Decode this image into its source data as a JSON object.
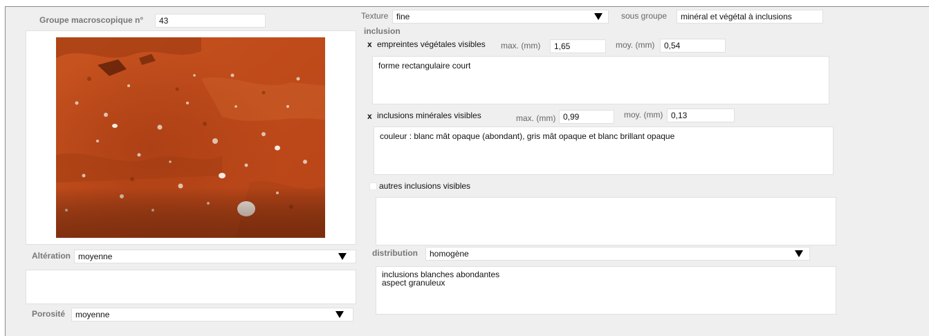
{
  "left": {
    "groupe_label": "Groupe macroscopique n°",
    "groupe_value": "43",
    "photo_icon": "soil-sample-photo",
    "alteration_label": "Altération",
    "alteration_value": "moyenne",
    "alteration_notes": "",
    "porosite_label": "Porosité",
    "porosite_value": "moyenne",
    "dropdown_icon": "triangle-down-icon"
  },
  "right": {
    "texture_label": "Texture",
    "texture_value": "fine",
    "sous_groupe_label": "sous groupe",
    "sous_groupe_value": "minéral et végétal à inclusions",
    "inclusion_heading": "inclusion",
    "veg": {
      "check": "x",
      "label": "empreintes végétales visibles",
      "max_label": "max. (mm)",
      "max_value": "1,65",
      "moy_label": "moy. (mm)",
      "moy_value": "0,54",
      "notes": "forme rectangulaire court"
    },
    "min": {
      "check": "x",
      "label": "inclusions minérales visibles",
      "max_label": "max. (mm)",
      "max_value": "0,99",
      "moy_label": "moy. (mm)",
      "moy_value": "0,13",
      "notes": "couleur : blanc mât opaque (abondant), gris mât opaque et blanc brillant opaque"
    },
    "autres": {
      "label": "autres inclusions visibles",
      "notes": ""
    },
    "distribution_label": "distribution",
    "distribution_value": "homogène",
    "distribution_notes": [
      "inclusions blanches abondantes",
      "aspect granuleux"
    ]
  },
  "colors": {
    "panel": "#efefef",
    "field": "#ffffff",
    "photo_base": "#c4501f"
  }
}
